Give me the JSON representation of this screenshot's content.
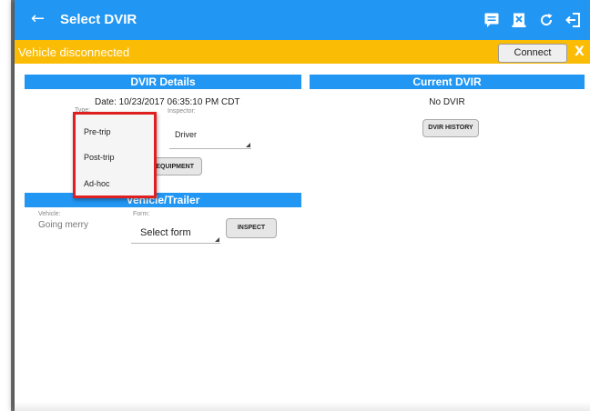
{
  "appbar": {
    "title": "Select DVIR",
    "back_icon": "arrow-left-icon",
    "actions": [
      "message-icon",
      "dvir-icon",
      "refresh-icon",
      "logout-icon"
    ]
  },
  "banner": {
    "text": "Vehicle disconnected",
    "connect_label": "Connect",
    "close_label": "X",
    "color": "#fbbc05"
  },
  "details": {
    "header": "DVIR Details",
    "date": "Date: 10/23/2017 06:35:10 PM CDT",
    "type_label": "Type:",
    "inspector_label": "Inspector:",
    "inspector_value": "Driver",
    "equipment_button": "EQUIPMENT"
  },
  "type_menu": {
    "options": [
      "Pre-trip",
      "Post-trip",
      "Ad-hoc"
    ]
  },
  "vehicle": {
    "header": "Vehicle/Trailer",
    "vehicle_label": "Vehicle:",
    "vehicle_value": "Going merry",
    "form_label": "Form:",
    "form_value": "Select form",
    "inspect_button": "INSPECT"
  },
  "current": {
    "header": "Current DVIR",
    "status": "No DVIR",
    "history_button": "DVIR HISTORY"
  },
  "colors": {
    "primary": "#2196f3",
    "highlight": "#e02020"
  }
}
